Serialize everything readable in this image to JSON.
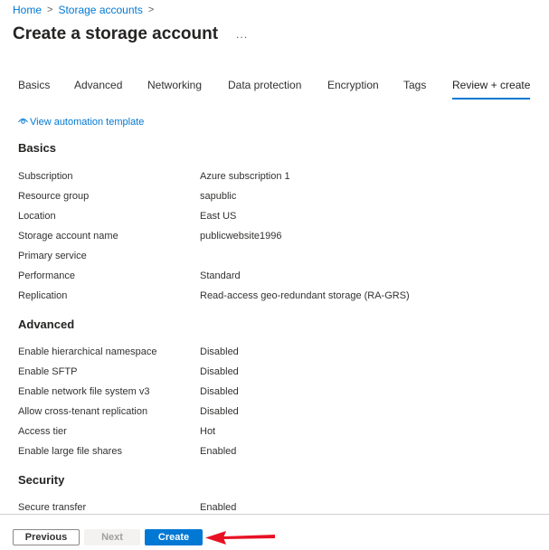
{
  "breadcrumb": [
    {
      "label": "Home"
    },
    {
      "label": "Storage accounts"
    }
  ],
  "breadcrumb_separator": ">",
  "page_title": "Create a storage account",
  "more_label": "...",
  "tabs": [
    {
      "label": "Basics",
      "active": false
    },
    {
      "label": "Advanced",
      "active": false
    },
    {
      "label": "Networking",
      "active": false
    },
    {
      "label": "Data protection",
      "active": false
    },
    {
      "label": "Encryption",
      "active": false
    },
    {
      "label": "Tags",
      "active": false
    },
    {
      "label": "Review + create",
      "active": true
    }
  ],
  "automation_link": {
    "label": "View automation template",
    "icon": "eye-icon"
  },
  "sections": {
    "basics": {
      "title": "Basics",
      "rows": [
        {
          "key": "Subscription",
          "value": "Azure subscription 1"
        },
        {
          "key": "Resource group",
          "value": "sapublic"
        },
        {
          "key": "Location",
          "value": "East US"
        },
        {
          "key": "Storage account name",
          "value": "publicwebsite1996"
        },
        {
          "key": "Primary service",
          "value": ""
        },
        {
          "key": "Performance",
          "value": "Standard"
        },
        {
          "key": "Replication",
          "value": "Read-access geo-redundant storage (RA-GRS)"
        }
      ]
    },
    "advanced": {
      "title": "Advanced",
      "rows": [
        {
          "key": "Enable hierarchical namespace",
          "value": "Disabled"
        },
        {
          "key": "Enable SFTP",
          "value": "Disabled"
        },
        {
          "key": "Enable network file system v3",
          "value": "Disabled"
        },
        {
          "key": "Allow cross-tenant replication",
          "value": "Disabled"
        },
        {
          "key": "Access tier",
          "value": "Hot"
        },
        {
          "key": "Enable large file shares",
          "value": "Enabled"
        }
      ]
    },
    "security": {
      "title": "Security",
      "rows": [
        {
          "key": "Secure transfer",
          "value": "Enabled"
        }
      ]
    }
  },
  "footer": {
    "previous_label": "Previous",
    "next_label": "Next",
    "create_label": "Create"
  },
  "colors": {
    "accent": "#0078d4",
    "annotation_arrow": "#e81123"
  }
}
